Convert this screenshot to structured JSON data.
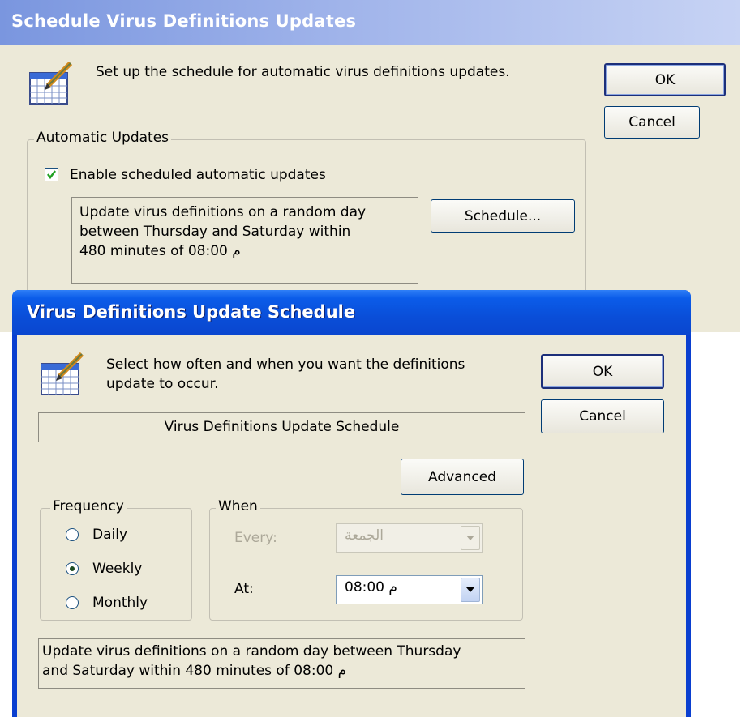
{
  "back_dialog": {
    "title": "Schedule Virus Definitions Updates",
    "description": "Set up the schedule for automatic virus definitions updates.",
    "ok_label": "OK",
    "cancel_label": "Cancel",
    "group_label": "Automatic Updates",
    "checkbox_label": "Enable scheduled automatic updates",
    "checkbox_checked": true,
    "summary_line1": "Update virus definitions on a random day",
    "summary_line2": "between Thursday and Saturday within",
    "summary_line3": "480 minutes of 08:00 م",
    "schedule_button_label": "Schedule..."
  },
  "front_dialog": {
    "title": "Virus Definitions Update Schedule",
    "description_line1": "Select how often and when you want the definitions",
    "description_line2": "update to occur.",
    "ok_label": "OK",
    "cancel_label": "Cancel",
    "banner_label": "Virus Definitions Update Schedule",
    "advanced_label": "Advanced",
    "frequency": {
      "label": "Frequency",
      "options": [
        "Daily",
        "Weekly",
        "Monthly"
      ],
      "selected": "Weekly"
    },
    "when": {
      "label": "When",
      "every_label": "Every:",
      "every_value": "الجمعة",
      "at_label": "At:",
      "at_value": "08:00 م"
    },
    "summary_line1": "Update virus definitions on a random day between Thursday",
    "summary_line2": "and Saturday within 480 minutes of 08:00 م"
  },
  "icons": {
    "calendar": "calendar-pencil-icon",
    "dropdown": "chevron-down-icon",
    "check": "checkmark-icon"
  },
  "colors": {
    "dialog_bg": "#ece9d8",
    "titlebar_active": "#0a4ed8",
    "titlebar_inactive": "#7a96df"
  }
}
